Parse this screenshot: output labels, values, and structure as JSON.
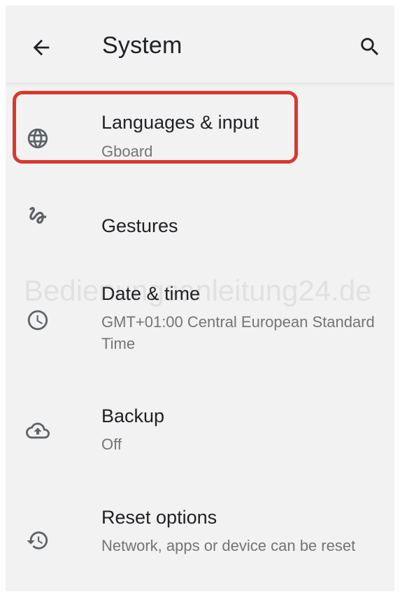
{
  "appbar": {
    "title": "System"
  },
  "items": [
    {
      "label": "Languages & input",
      "sub": "Gboard",
      "icon": "globe-icon"
    },
    {
      "label": "Gestures",
      "sub": "",
      "icon": "gesture-icon"
    },
    {
      "label": "Date & time",
      "sub": "GMT+01:00 Central European Standard Time",
      "icon": "clock-icon"
    },
    {
      "label": "Backup",
      "sub": "Off",
      "icon": "cloud-upload-icon"
    },
    {
      "label": "Reset options",
      "sub": "Network, apps or device can be reset",
      "icon": "history-icon"
    }
  ],
  "watermark": "Bedienungsanleitung24.de",
  "colors": {
    "highlight": "#d9382e",
    "background": "#f2f2f2",
    "primary_text": "#202124",
    "secondary_text": "#747474"
  }
}
